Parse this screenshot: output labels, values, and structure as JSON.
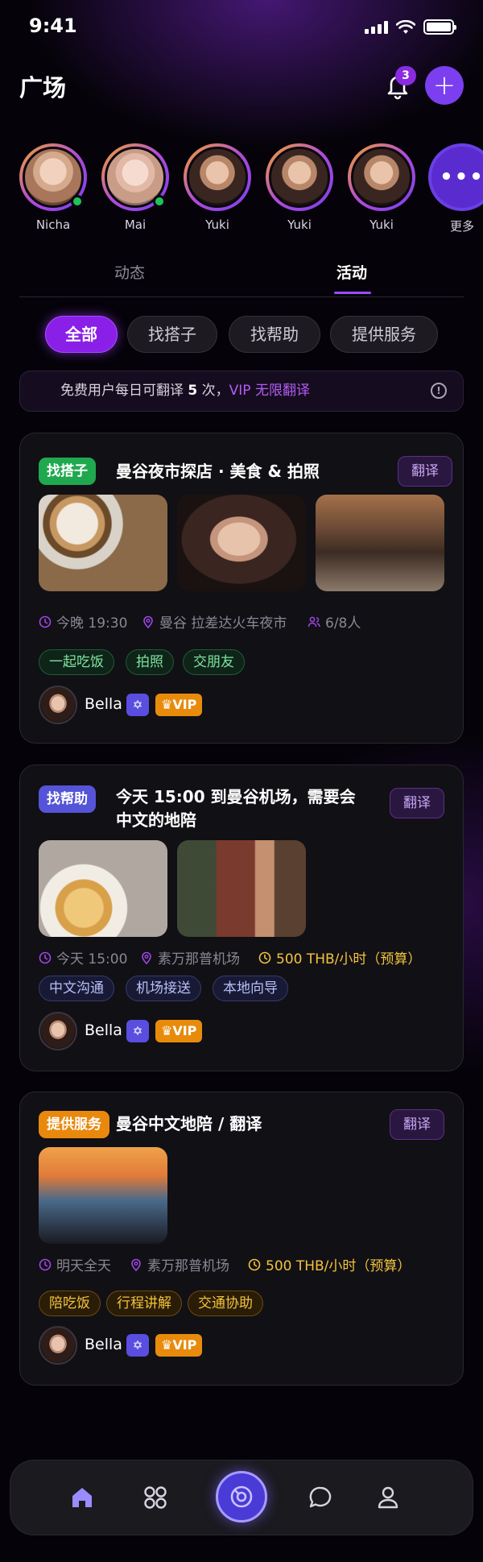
{
  "status_bar": {
    "time": "9:41"
  },
  "header": {
    "title": "广场",
    "notification_count": "3",
    "add_icon": "plus-icon",
    "bell_icon": "bell-icon"
  },
  "stories": [
    {
      "name": "Nicha",
      "online": true
    },
    {
      "name": "Mai",
      "online": true
    },
    {
      "name": "Yuki",
      "online": false
    },
    {
      "name": "Yuki",
      "online": false
    },
    {
      "name": "Yuki",
      "online": false
    }
  ],
  "stories_more": {
    "label": "更多",
    "icon": "more-dots-icon"
  },
  "tabs": [
    {
      "label": "动态",
      "active": false
    },
    {
      "label": "活动",
      "active": true
    }
  ],
  "filters": [
    {
      "label": "全部",
      "active": true
    },
    {
      "label": "找搭子",
      "active": false
    },
    {
      "label": "找帮助",
      "active": false
    },
    {
      "label": "提供服务",
      "active": false
    }
  ],
  "notice": {
    "prefix": "免费用户每日可翻译",
    "count": "5",
    "suffix": "次，",
    "vip_text": "VIP 无限翻译",
    "icon": "info-icon"
  },
  "cards": [
    {
      "tag": "找搭子",
      "title": "曼谷夜市探店 · 美食 & 拍照",
      "translate": "翻译",
      "time": "今晚 19:30",
      "location": "曼谷 拉差达火车夜市",
      "people": "6/8人",
      "pills": [
        "一起吃饭",
        "拍照",
        "交朋友"
      ],
      "user": "Bella",
      "vip": "VIP"
    },
    {
      "tag": "找帮助",
      "title": "今天 15:00 到曼谷机场，需要会中文的地陪",
      "translate": "翻译",
      "time": "今天 15:00",
      "location": "素万那普机场",
      "price": "500 THB/小时（预算）",
      "pills": [
        "中文沟通",
        "机场接送",
        "本地向导"
      ],
      "user": "Bella",
      "vip": "VIP"
    },
    {
      "tag": "提供服务",
      "title": "曼谷中文地陪 / 翻译",
      "translate": "翻译",
      "time": "明天全天",
      "location": "素万那普机场",
      "price": "500 THB/小时（预算）",
      "pills": [
        "陪吃饭",
        "行程讲解",
        "交通协助"
      ],
      "user": "Bella",
      "vip": "VIP"
    }
  ],
  "colors": {
    "accent": "#8a1fe8",
    "green_tag": "#20a84f",
    "blue_tag": "#5554d8",
    "orange_tag": "#e8890d",
    "vip": "#e88b0c"
  },
  "nav": {
    "items": [
      "home-icon",
      "grid-icon",
      "discover-icon",
      "chat-icon",
      "profile-icon"
    ]
  }
}
